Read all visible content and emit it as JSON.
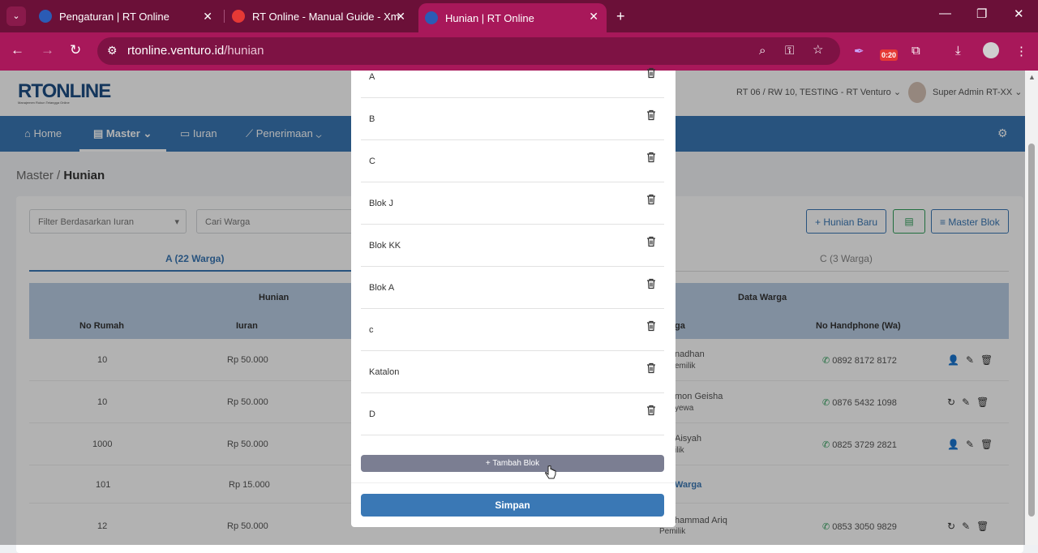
{
  "browser": {
    "tab_search_icon": "chevron-down-icon",
    "tabs": [
      {
        "title": "Pengaturan | RT Online",
        "favicon_color": "#2b5bb5"
      },
      {
        "title": "RT Online - Manual Guide - Xm",
        "favicon_color": "#e53935"
      },
      {
        "title": "Hunian | RT Online",
        "favicon_color": "#2b5bb5",
        "active": true
      }
    ],
    "tab_close": "✕",
    "new_tab": "+",
    "url_host": "rtonline.venturo.id",
    "url_path": "/hunian",
    "badge": "0:20"
  },
  "app": {
    "logo": "RT",
    "logo_rest": "ONLINE",
    "logo_tagline": "Manajemen Rukun Tetangga Online",
    "rt_select": "RT 06 / RW 10, TESTING - RT Venturo",
    "user": "Super Admin RT-XX",
    "nav": [
      {
        "label": "Home",
        "icon": "⌂"
      },
      {
        "label": "Master",
        "icon": "▤",
        "active": true
      },
      {
        "label": "Iuran",
        "icon": "▭"
      },
      {
        "label": "Penerimaan",
        "icon": "⟋"
      }
    ],
    "breadcrumb_parent": "Master",
    "breadcrumb_sep": "/",
    "breadcrumb_current": "Hunian",
    "filter_iuran_placeholder": "Filter Berdasarkan Iuran",
    "search_placeholder": "Cari Warga",
    "btn_hunian_baru": "+ Hunian Baru",
    "btn_master_blok": "Master Blok",
    "tabs": [
      {
        "label": "A (22 Warga)",
        "active": true
      },
      {
        "label": "C (3 Warga)"
      }
    ],
    "table": {
      "group_hunian": "Hunian",
      "group_data_warga": "Data Warga",
      "col_no_rumah": "No Rumah",
      "col_iuran": "Iuran",
      "col_warga": "ga",
      "col_no_hp": "No Handphone (Wa)",
      "rows": [
        {
          "no": "10",
          "iuran": "Rp 50.000",
          "nama": "nadhan",
          "status": "emilik",
          "hp": "0892 8172 8172"
        },
        {
          "no": "10",
          "iuran": "Rp 50.000",
          "nama": "mon Geisha",
          "status": "yewa",
          "hp": "0876 5432 1098"
        },
        {
          "no": "1000",
          "iuran": "Rp 50.000",
          "nama": "Aisyah",
          "status": "ilik",
          "hp": "0825 3729 2821"
        },
        {
          "no": "101",
          "iuran": "Rp 15.000",
          "nama": "Warga",
          "status": "",
          "hp": ""
        },
        {
          "no": "12",
          "iuran": "Rp 50.000",
          "nama": "hammad Ariq",
          "status": "Pemilik",
          "hp": "0853 3050 9829"
        }
      ]
    }
  },
  "modal": {
    "bloks": [
      "A",
      "B",
      "C",
      "Blok J",
      "Blok KK",
      "Blok A",
      "c",
      "Katalon",
      "D"
    ],
    "tambah_label": "+ Tambah Blok",
    "simpan_label": "Simpan"
  }
}
